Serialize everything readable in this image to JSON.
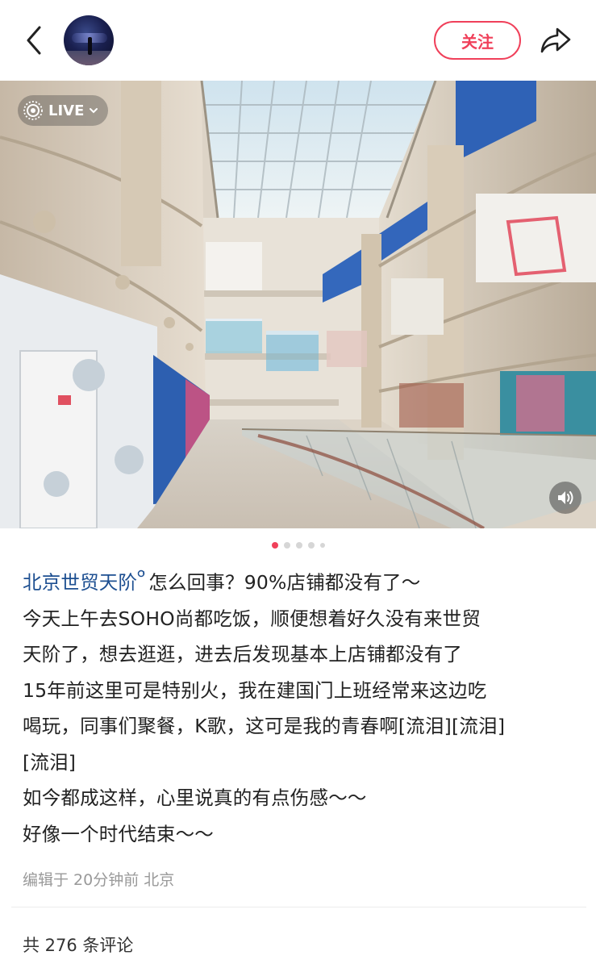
{
  "header": {
    "follow_label": "关注"
  },
  "photo": {
    "live_label": "LIVE",
    "carousel": {
      "total": 5,
      "current": 1
    }
  },
  "post": {
    "topic": "北京世贸天阶",
    "title_rest": "怎么回事？90%店铺都没有了～",
    "lines": [
      "今天上午去SOHO尚都吃饭，顺便想着好久没有来世贸",
      "天阶了，想去逛逛，进去后发现基本上店铺都没有了",
      "15年前这里可是特别火，我在建国门上班经常来这边吃",
      "喝玩，同事们聚餐，K歌，这可是我的青春啊[流泪][流泪]",
      "[流泪]",
      "如今都成这样，心里说真的有点伤感～～",
      "好像一个时代结束～～"
    ],
    "meta": "编辑于 20分钟前 北京"
  },
  "comments": {
    "summary": "共 276 条评论"
  },
  "icons": {
    "back": "chevron-left-icon",
    "share": "share-arrow-icon",
    "live": "live-photo-icon",
    "sound": "speaker-icon",
    "topic": "topic-tag-icon"
  },
  "colors": {
    "accent": "#f0405a",
    "topic": "#1d4f91",
    "meta": "#999999"
  }
}
